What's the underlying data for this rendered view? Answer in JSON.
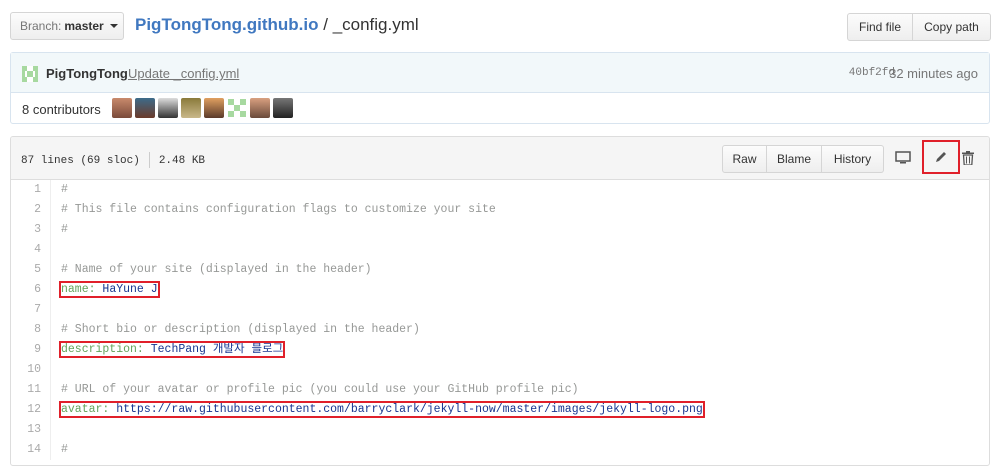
{
  "top": {
    "branch_prefix": "Branch:",
    "branch_name": "master",
    "repo": "PigTongTong.github.io",
    "separator": "/",
    "file": "_config.yml",
    "find_file": "Find file",
    "copy_path": "Copy path"
  },
  "commit": {
    "author": "PigTongTong",
    "message": "Update _config.yml",
    "sha": "40bf2fd",
    "time": "32 minutes ago",
    "contributors_label": "8 contributors"
  },
  "file": {
    "info_lines": "87 lines (69 sloc)",
    "info_size": "2.48 KB",
    "raw": "Raw",
    "blame": "Blame",
    "history": "History"
  },
  "code": {
    "lines": [
      {
        "n": "1",
        "text": "#"
      },
      {
        "n": "2",
        "text": "# This file contains configuration flags to customize your site"
      },
      {
        "n": "3",
        "text": "#"
      },
      {
        "n": "4",
        "text": ""
      },
      {
        "n": "5",
        "text": "# Name of your site (displayed in the header)"
      },
      {
        "n": "6",
        "key": "name:",
        "value": "HaYune J"
      },
      {
        "n": "7",
        "text": ""
      },
      {
        "n": "8",
        "text": "# Short bio or description (displayed in the header)"
      },
      {
        "n": "9",
        "key": "description:",
        "value": "TechPang 개발자 블로그"
      },
      {
        "n": "10",
        "text": ""
      },
      {
        "n": "11",
        "text": "# URL of your avatar or profile pic (you could use your GitHub profile pic)"
      },
      {
        "n": "12",
        "key": "avatar:",
        "value": "https://raw.githubusercontent.com/barryclark/jekyll-now/master/images/jekyll-logo.png"
      },
      {
        "n": "13",
        "text": ""
      },
      {
        "n": "14",
        "text": "#"
      }
    ]
  },
  "colors": {
    "link": "#4078c0",
    "highlight_box": "#e0202a",
    "yaml_key": "#63a35c",
    "yaml_value": "#183691",
    "comment": "#969896"
  },
  "icons": [
    "identicon",
    "display-icon",
    "pencil-icon",
    "trashcan-icon",
    "caret-down-icon"
  ]
}
